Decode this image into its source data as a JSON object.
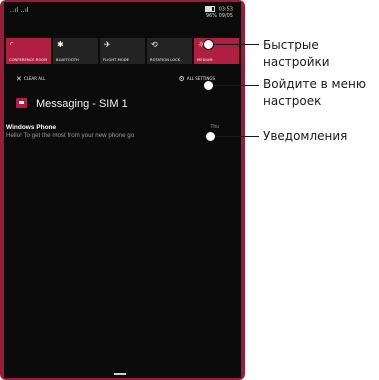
{
  "status_bar": {
    "signal_text": "..ıl ..ıl",
    "time": "03:53",
    "date_line": "96% 09/05"
  },
  "quick_settings": [
    {
      "icon": "wifi-icon",
      "glyph": "◜",
      "label": "Conference room",
      "active": true
    },
    {
      "icon": "bluetooth-icon",
      "glyph": "✱",
      "label": "Bluetooth",
      "active": false
    },
    {
      "icon": "airplane-icon",
      "glyph": "✈",
      "label": "Flight mode",
      "active": false
    },
    {
      "icon": "rotation-lock-icon",
      "glyph": "⟲",
      "label": "Rotation lock",
      "active": false
    },
    {
      "icon": "brightness-icon",
      "glyph": "☼",
      "label": "Medium",
      "active": true
    }
  ],
  "actions": {
    "clear_all": "CLEAR ALL",
    "all_settings": "ALL SETTINGS"
  },
  "notification_group": {
    "app": "Messaging - SIM 1"
  },
  "notification": {
    "title": "Windows Phone",
    "body": "Hello! To get the most from your new phone go",
    "time": "Thu"
  },
  "callouts": {
    "quick_settings": "Быстрые\nнастройки",
    "settings_menu": "Войдите в меню\nнастроек",
    "notifications": "Уведомления"
  },
  "colors": {
    "accent": "#b01e42",
    "frame": "#9c1a3a",
    "screen": "#0b0b0b"
  }
}
